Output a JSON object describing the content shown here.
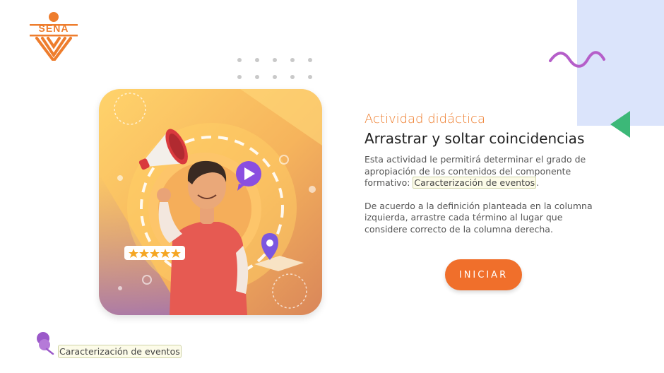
{
  "logo": {
    "text": "SENA"
  },
  "content": {
    "subtitle": "Actividad didáctica",
    "title": "Arrastrar y soltar coincidencias",
    "para1_before": "Esta actividad le permitirá determinar el grado de apropiación de los contenidos del componente formativo: ",
    "para1_highlight": "Caracterización de eventos",
    "para1_after": ".",
    "para2": "De acuerdo a la definición planteada en la columna izquierda, arrastre cada término al lugar que considere correcto de la columna derecha."
  },
  "button": {
    "label": "INICIAR"
  },
  "footer": {
    "label": "Caracterización de eventos"
  },
  "colors": {
    "accent": "#ee7d2d",
    "button": "#f06f2b",
    "wave": "#b55ec9",
    "triangle": "#3cb878",
    "blue_block": "#dbe4fb"
  },
  "icons": [
    "sena-logo",
    "wave-icon",
    "triangle-icon",
    "megaphone-icon",
    "play-icon",
    "location-pin-icon",
    "stars-icon",
    "pin-icon"
  ]
}
